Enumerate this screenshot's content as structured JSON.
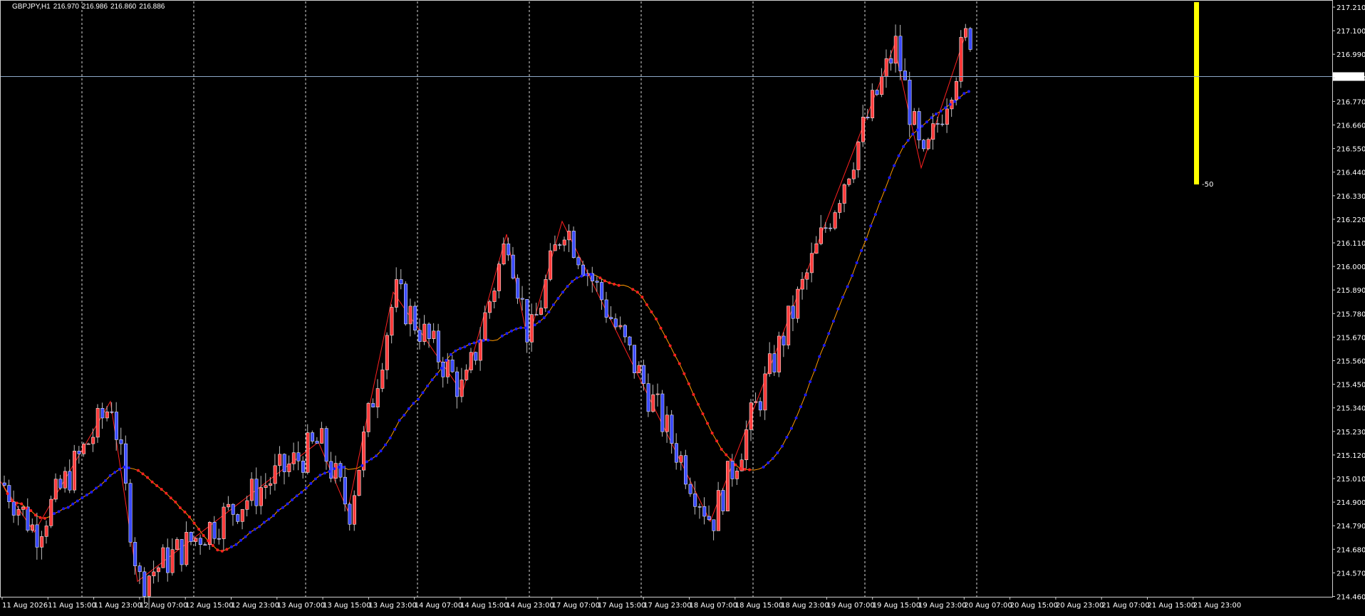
{
  "header": {
    "symbol": "GBPJPY,H1",
    "open": "216.970",
    "high": "216.986",
    "low": "216.860",
    "close": "216.886"
  },
  "colors": {
    "background": "#000000",
    "bull_candle": "#ff3b3b",
    "bear_candle": "#3b4bff",
    "grid": "#ffffff",
    "zigzag": "#ff2020",
    "moving_average": "#ff9900",
    "dot_up": "#1a1aff",
    "dot_down": "#ff2020",
    "volume_bar": "#ffff00",
    "price_line": "#8ea8c8"
  },
  "price_axis": {
    "labels": [
      "217.210",
      "217.100",
      "216.990",
      "216.880",
      "216.770",
      "216.660",
      "216.550",
      "216.440",
      "216.330",
      "216.220",
      "216.110",
      "216.000",
      "215.890",
      "215.780",
      "215.670",
      "215.560",
      "215.450",
      "215.340",
      "215.230",
      "215.120",
      "215.010",
      "214.900",
      "214.790",
      "214.680",
      "214.570",
      "214.460"
    ],
    "current_price": "216.886"
  },
  "time_axis": {
    "labels": [
      "11 Aug 2026",
      "11 Aug 15:00",
      "11 Aug 23:00",
      "12 Aug 07:00",
      "12 Aug 15:00",
      "12 Aug 23:00",
      "13 Aug 07:00",
      "13 Aug 15:00",
      "13 Aug 23:00",
      "14 Aug 07:00",
      "14 Aug 15:00",
      "14 Aug 23:00",
      "17 Aug 07:00",
      "17 Aug 15:00",
      "17 Aug 23:00",
      "18 Aug 07:00",
      "18 Aug 15:00",
      "18 Aug 23:00",
      "19 Aug 07:00",
      "19 Aug 15:00",
      "19 Aug 23:00",
      "20 Aug 07:00",
      "20 Aug 15:00",
      "20 Aug 23:00",
      "21 Aug 07:00",
      "21 Aug 15:00",
      "21 Aug 23:00"
    ]
  },
  "indicator": {
    "level_label": "-50"
  },
  "chart_data": {
    "type": "candlestick",
    "symbol": "GBPJPY",
    "timeframe": "H1",
    "ylim": [
      214.46,
      217.21
    ],
    "zigzag_points": [
      {
        "x": "11 Aug 2026",
        "y": 215.0
      },
      {
        "x": "11 Aug 07:00",
        "y": 214.76
      },
      {
        "x": "11 Aug 19:00",
        "y": 215.37
      },
      {
        "x": "12 Aug 02:00",
        "y": 214.53
      },
      {
        "x": "13 Aug 14:00",
        "y": 215.18
      },
      {
        "x": "14 Aug 04:00",
        "y": 214.86
      },
      {
        "x": "14 Aug 16:00",
        "y": 215.88
      },
      {
        "x": "17 Aug 07:00",
        "y": 215.41
      },
      {
        "x": "17 Aug 16:00",
        "y": 216.15
      },
      {
        "x": "17 Aug 23:00",
        "y": 215.65
      },
      {
        "x": "18 Aug 05:00",
        "y": 216.21
      },
      {
        "x": "19 Aug 12:00",
        "y": 214.81
      },
      {
        "x": "20 Aug 23:00",
        "y": 217.03
      },
      {
        "x": "21 Aug 07:00",
        "y": 216.46
      },
      {
        "x": "21 Aug 23:00",
        "y": 217.08
      }
    ],
    "last_close": 216.886
  }
}
